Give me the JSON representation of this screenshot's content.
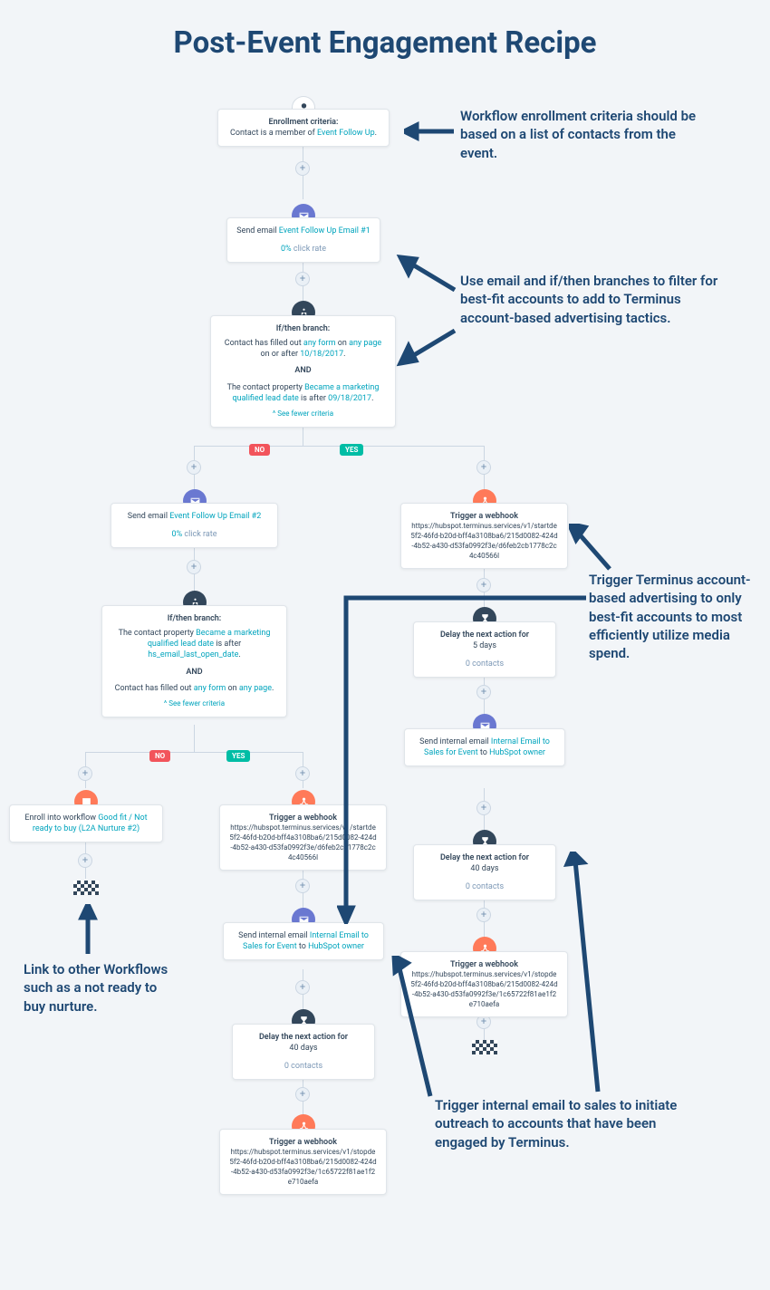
{
  "title": "Post-Event Engagement Recipe",
  "ann": {
    "a1": "Workflow enrollment criteria should be based on a list of contacts from the event.",
    "a2": "Use email and if/then branches to filter for best-fit accounts to add to Terminus account-based advertising tactics.",
    "a3": "Trigger Terminus account-based advertising to only best-fit accounts to most efficiently utilize media spend.",
    "a4": "Link to other Workflows such as a not ready to buy nurture.",
    "a5": "Trigger internal email to sales to initiate outreach to accounts that have been engaged by Terminus."
  },
  "labels": {
    "no": "NO",
    "yes": "YES",
    "see": "^ See fewer criteria"
  },
  "enroll": {
    "hdr": "Enrollment criteria:",
    "pre": "Contact is a member of ",
    "link": "Event Follow Up",
    "post": "."
  },
  "email1": {
    "pre": "Send email ",
    "link": "Event Follow Up Email #1",
    "rate": "0% click rate"
  },
  "branch1": {
    "hdr": "If/then branch:",
    "l1a": "Contact has filled out ",
    "l1b": "any form",
    "l1c": " on ",
    "l1d": "any page",
    "l1e": " on or after ",
    "l1f": "10/18/2017",
    "l1g": ".",
    "and": "AND",
    "l2a": "The contact property ",
    "l2b": "Became a marketing qualified lead date",
    "l2c": " is after ",
    "l2d": "09/18/2017",
    "l2e": "."
  },
  "email2": {
    "pre": "Send email ",
    "link": "Event Follow Up Email #2",
    "rate": "0% click rate"
  },
  "branch2": {
    "hdr": "If/then branch:",
    "l1a": "The contact property ",
    "l1b": "Became a marketing qualified lead date",
    "l1c": " is after ",
    "l1d": "hs_email_last_open_date",
    "l1e": ".",
    "and": "AND",
    "l2a": "Contact has filled out ",
    "l2b": "any form",
    "l2c": " on ",
    "l2d": "any page",
    "l2e": "."
  },
  "wf": {
    "pre": "Enroll into workflow ",
    "link": "Good fit / Not ready to buy (L2A Nurture #2)"
  },
  "hook1": {
    "hdr": "Trigger a webhook",
    "url": "https://hubspot.terminus.services/v1/startde5f2-46fd-b20d-bff4a3108ba6/215d0082-424d-4b52-a430-d53fa0992f3e/d6feb2cb1778c2c4c40566l"
  },
  "hook2": {
    "hdr": "Trigger a webhook",
    "url": "https://hubspot.terminus.services/v1/stopde5f2-46fd-b20d-bff4a3108ba6/215d0082-424d-4b52-a430-d53fa0992f3e/1c65722f81ae1f2e710aefa"
  },
  "internal": {
    "pre": "Send internal email ",
    "link": "Internal Email to Sales for Event",
    "mid": " to ",
    "owner": "HubSpot owner"
  },
  "delay5": {
    "hdr": "Delay the next action for",
    "days": "5 days",
    "cnt": "0 contacts"
  },
  "delay40": {
    "hdr": "Delay the next action for",
    "days": "40 days",
    "cnt": "0 contacts"
  }
}
